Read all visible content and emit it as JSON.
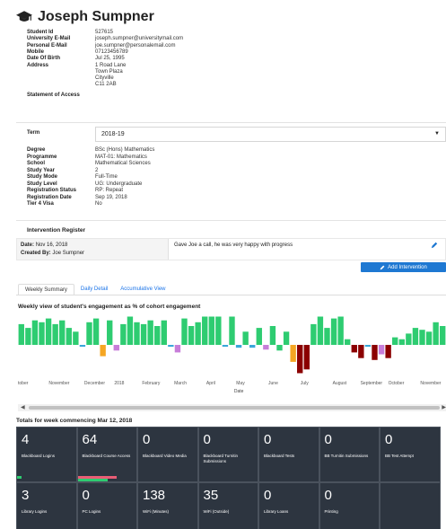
{
  "student": {
    "name": "Joseph Sumpner",
    "fields": [
      {
        "label": "Student Id",
        "value": "527615"
      },
      {
        "label": "University E-Mail",
        "value": "joseph.sumpner@universitymail.com"
      },
      {
        "label": "Personal E-Mail",
        "value": "joe.sumpner@personalemail.com"
      },
      {
        "label": "Mobile",
        "value": "07123456789"
      },
      {
        "label": "Date Of Birth",
        "value": "Jul 25, 1995"
      }
    ],
    "address_label": "Address",
    "address_lines": [
      "1 Road Lane",
      "Town Plaza",
      "Cityville",
      "C11 2AB"
    ],
    "statement_label": "Statement of Access"
  },
  "course": {
    "term_label": "Term",
    "term_value": "2018-19",
    "fields": [
      {
        "label": "Degree",
        "value": "BSc (Hons) Mathematics"
      },
      {
        "label": "Programme",
        "value": "MAT-01: Mathematics"
      },
      {
        "label": "School",
        "value": "Mathematical Sciences"
      },
      {
        "label": "Study Year",
        "value": "2"
      },
      {
        "label": "Study Mode",
        "value": "Full-Time"
      },
      {
        "label": "Study Level",
        "value": "UG: Undergraduate"
      },
      {
        "label": "Registration Status",
        "value": "RP: Repeat"
      },
      {
        "label": "Registration Date",
        "value": "Sep 19, 2018"
      },
      {
        "label": "Tier 4 Visa",
        "value": "No"
      }
    ]
  },
  "intervention": {
    "heading": "Intervention Register",
    "date_label": "Date:",
    "date_value": "Nov 16, 2018",
    "created_label": "Created By:",
    "created_value": "Joe Sumpner",
    "note": "Gave Joe a call, he was very happy with progress",
    "add_button": "Add Intervention",
    "edit_icon": "pencil-icon"
  },
  "tabs": [
    "Weekly Summary",
    "Daily Detail",
    "Accumulative View"
  ],
  "chart_title": "Weekly view of student's engagement as % of cohort engagement",
  "chart_data": {
    "type": "bar",
    "xlabel": "Date",
    "x_ticks": [
      "tober",
      "November",
      "December",
      "2018",
      "February",
      "March",
      "April",
      "May",
      "June",
      "July",
      "August",
      "September",
      "October",
      "November"
    ],
    "ylim": [
      -40,
      40
    ],
    "colors": {
      "positive": "#2ecc71",
      "negative_dark": "#8b0000",
      "orange": "#f5a623",
      "purple": "#c77dd9",
      "cyan": "#3aa7d9"
    },
    "values": [
      22,
      18,
      26,
      24,
      28,
      22,
      26,
      18,
      14,
      -2,
      24,
      28,
      -12,
      26,
      -6,
      22,
      30,
      24,
      22,
      26,
      20,
      26,
      -2,
      -8,
      28,
      20,
      24,
      30,
      30,
      30,
      -2,
      30,
      -3,
      14,
      -3,
      18,
      -5,
      20,
      -6,
      14,
      -18,
      -30,
      -26,
      22,
      30,
      18,
      28,
      30,
      6,
      -8,
      -14,
      -2,
      -16,
      -10,
      -14,
      8,
      6,
      12,
      18,
      16,
      14,
      24,
      20
    ],
    "bar_colors": [
      "g",
      "g",
      "g",
      "g",
      "g",
      "g",
      "g",
      "g",
      "g",
      "c",
      "g",
      "g",
      "o",
      "g",
      "p",
      "g",
      "g",
      "g",
      "g",
      "g",
      "g",
      "g",
      "c",
      "p",
      "g",
      "g",
      "g",
      "g",
      "g",
      "g",
      "c",
      "g",
      "c",
      "g",
      "c",
      "g",
      "p",
      "g",
      "g",
      "g",
      "o",
      "r",
      "r",
      "g",
      "g",
      "g",
      "g",
      "g",
      "g",
      "r",
      "r",
      "c",
      "r",
      "p",
      "r",
      "g",
      "g",
      "g",
      "g",
      "g",
      "g",
      "g",
      "g"
    ]
  },
  "totals_title": "Totals for week commencing Mar 12, 2018",
  "tiles_row1": [
    {
      "num": "4",
      "label": "Blackboard Logins",
      "bar": "#2ecc71",
      "barw": 0.08
    },
    {
      "num": "64",
      "label": "Blackboard Course Access",
      "bar": "#e85d75",
      "barw": 0.65,
      "bar2": "#2ecc71",
      "bar2w": 0.5
    },
    {
      "num": "0",
      "label": "Blackboard Video Media"
    },
    {
      "num": "0",
      "label": "Blackboard Turnitin Submissions"
    },
    {
      "num": "0",
      "label": "Blackboard Tests"
    },
    {
      "num": "0",
      "label": "BB Turnitin Submissions"
    },
    {
      "num": "0",
      "label": "BB Test Attempt"
    }
  ],
  "tiles_row2": [
    {
      "num": "3",
      "label": "Library Logins",
      "bar": "#2ecc71",
      "barw": 0.04
    },
    {
      "num": "0",
      "label": "PC Logins"
    },
    {
      "num": "138",
      "label": "WiFi (Minutes)"
    },
    {
      "num": "35",
      "label": "WiFi (Outside)"
    },
    {
      "num": "0",
      "label": "Library Loans"
    },
    {
      "num": "0",
      "label": "Printing"
    },
    {
      "num": "",
      "label": ""
    }
  ]
}
